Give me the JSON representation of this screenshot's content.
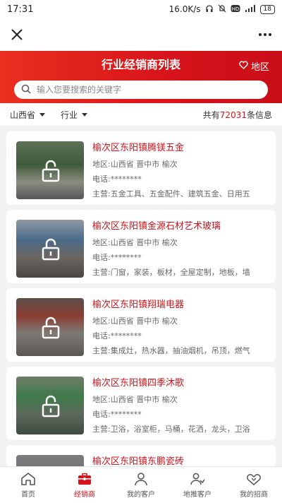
{
  "status_bar": {
    "time": "17:31",
    "net_speed": "16.0K/s",
    "battery": "18"
  },
  "header": {
    "title": "行业经销商列表",
    "region_label": "地区",
    "search_placeholder": "输入您要搜索的关键字"
  },
  "filters": {
    "province": "山西省",
    "industry": "行业"
  },
  "total": {
    "prefix": "共有",
    "count": "72031",
    "suffix": "条信息"
  },
  "dealers": [
    {
      "name": "榆次区东阳镇腾镁五金",
      "region": "地区:山西省 晋中市 榆次",
      "phone": "电话:********",
      "business": "主营:五金工具、五金配件、建筑五金、日用五"
    },
    {
      "name": "榆次区东阳镇金源石材艺术玻璃",
      "region": "地区:山西省 晋中市 榆次",
      "phone": "电话:********",
      "business": "主营:门窗，家装，板材，全屋定制，地板，墙"
    },
    {
      "name": "榆次区东阳镇翔瑞电器",
      "region": "地区:山西省 晋中市 榆次",
      "phone": "电话:********",
      "business": "主营:集成灶，热水器，抽油烟机，吊顶，燃气"
    },
    {
      "name": "榆次区东阳镇四季沐歌",
      "region": "地区:山西省 晋中市 榆次",
      "phone": "电话:********",
      "business": "主营:卫浴，浴室柜，马桶，花洒，龙头，卫浴"
    },
    {
      "name": "榆次区东阳镇东鹏瓷砖"
    }
  ],
  "tabs": [
    {
      "label": "首页"
    },
    {
      "label": "经销商"
    },
    {
      "label": "我的客户"
    },
    {
      "label": "地推客户"
    },
    {
      "label": "我的招商"
    }
  ],
  "colors": {
    "brand_red": "#d8131b",
    "title_red": "#c5161d"
  }
}
